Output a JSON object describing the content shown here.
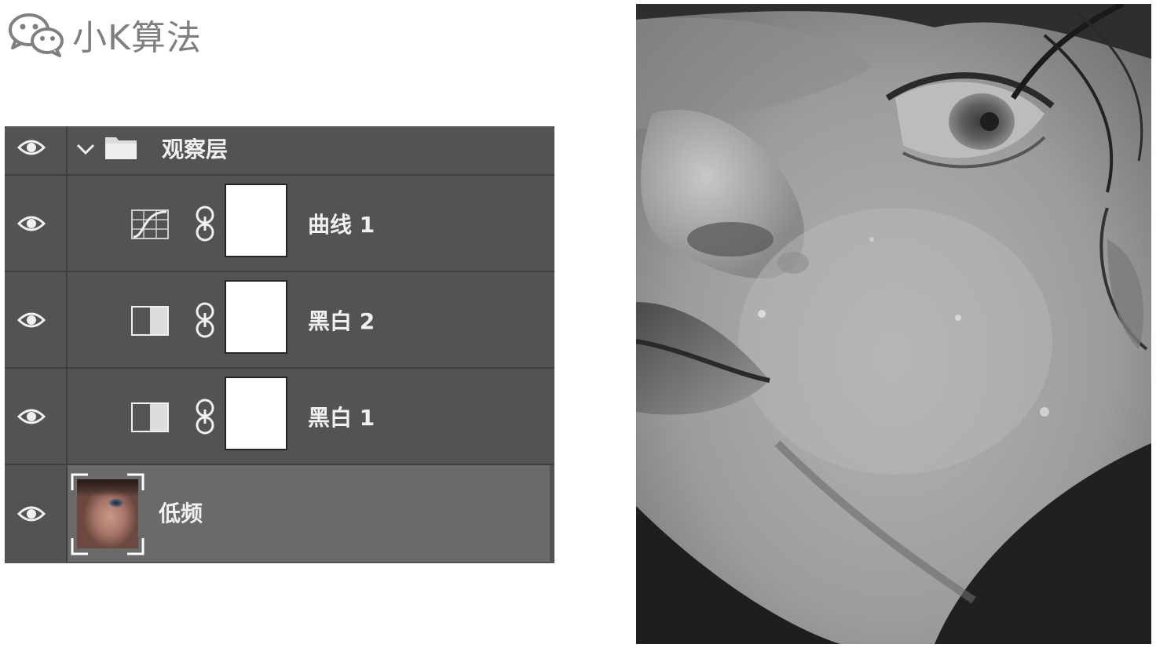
{
  "watermark": {
    "icon": "wechat-icon",
    "text": "小K算法"
  },
  "layers_panel": {
    "group": {
      "name": "观察层",
      "expanded": true,
      "icons": [
        "eye-icon",
        "chevron-down-icon",
        "folder-icon"
      ]
    },
    "layers": [
      {
        "name": "曲线 1",
        "icon": "curves-adjustment-icon",
        "mask": "white"
      },
      {
        "name": "黑白 2",
        "icon": "black-white-adjustment-icon",
        "mask": "white"
      },
      {
        "name": "黑白 1",
        "icon": "black-white-adjustment-icon",
        "mask": "white"
      }
    ],
    "base_layer": {
      "name": "低频",
      "selected": true
    },
    "colors": {
      "panel_bg": "#535353",
      "selected_bg": "#6a6a6a",
      "separator": "#3f3f3f",
      "text": "#f0f0f0"
    }
  },
  "preview": {
    "subject": "grayscale close-up of a face",
    "colors": {
      "dark": "#1a1a1a",
      "mid": "#8a8a8a",
      "light": "#d0d0d0"
    }
  }
}
